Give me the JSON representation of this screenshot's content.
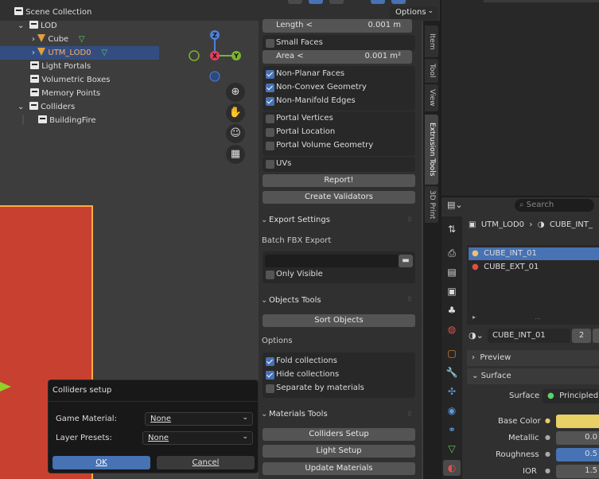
{
  "viewport": {
    "options_label": "Options",
    "gizmo": {
      "z": "Z",
      "x": "X",
      "y": "Y"
    }
  },
  "npanel": {
    "length_label": "Length <",
    "length_value": "0.001 m",
    "small_faces": "Small Faces",
    "area_label": "Area <",
    "area_value": "0.001 m²",
    "non_planar": "Non-Planar Faces",
    "non_convex": "Non-Convex Geometry",
    "non_manifold": "Non-Manifold Edges",
    "portal_vertices": "Portal Vertices",
    "portal_location": "Portal Location",
    "portal_volume": "Portal Volume Geometry",
    "uvs": "UVs",
    "report_btn": "Report!",
    "create_validators_btn": "Create Validators",
    "export_settings": "Export Settings",
    "batch_fbx": "Batch FBX Export",
    "only_visible": "Only Visible",
    "objects_tools": "Objects Tools",
    "sort_objects_btn": "Sort Objects",
    "options_label": "Options",
    "fold_collections": "Fold collections",
    "hide_collections": "Hide collections",
    "separate_materials": "Separate by materials",
    "materials_tools": "Materials Tools",
    "colliders_setup_btn": "Colliders Setup",
    "light_setup_btn": "Light Setup",
    "update_materials_btn": "Update Materials",
    "tabs": [
      "Item",
      "Tool",
      "View",
      "Extrusion Tools",
      "3D Print"
    ]
  },
  "outliner": {
    "rows": [
      {
        "label": "Scene Collection"
      },
      {
        "label": "LOD"
      },
      {
        "label": "Cube"
      },
      {
        "label": "UTM_LOD0"
      },
      {
        "label": "Light Portals"
      },
      {
        "label": "Volumetric Boxes"
      },
      {
        "label": "Memory Points"
      },
      {
        "label": "Colliders"
      },
      {
        "label": "BuildingFire"
      }
    ]
  },
  "properties": {
    "search_placeholder": "Search",
    "breadcrumb_object": "UTM_LOD0",
    "breadcrumb_material": "CUBE_INT_",
    "slots": [
      "CUBE_INT_01",
      "CUBE_EXT_01"
    ],
    "material_name": "CUBE_INT_01",
    "users": "2",
    "preview": "Preview",
    "surface_section": "Surface",
    "surface_label": "Surface",
    "surface_value": "Principled B",
    "base_color": "Base Color",
    "metallic": "Metallic",
    "metallic_value": "0.0",
    "roughness": "Roughness",
    "roughness_value": "0.5",
    "ior": "IOR",
    "ior_value": "1.5",
    "colors": {
      "base_color": "#e8cf66"
    }
  },
  "dialog": {
    "title": "Colliders setup",
    "game_material_label": "Game Material:",
    "game_material_value": "None",
    "layer_presets_label": "Layer Presets:",
    "layer_presets_value": "None",
    "ok": "OK",
    "cancel": "Cancel"
  }
}
